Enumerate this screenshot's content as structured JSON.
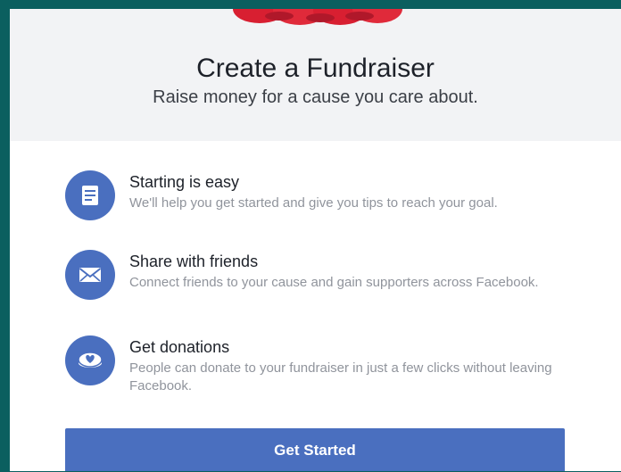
{
  "header": {
    "title": "Create a Fundraiser",
    "subtitle": "Raise money for a cause you care about."
  },
  "features": [
    {
      "icon": "document-icon",
      "title": "Starting is easy",
      "description": "We'll help you get started and give you tips to reach your goal."
    },
    {
      "icon": "envelope-icon",
      "title": "Share with friends",
      "description": "Connect friends to your cause and gain supporters across Facebook."
    },
    {
      "icon": "heart-coin-icon",
      "title": "Get donations",
      "description": "People can donate to your fundraiser in just a few clicks without leaving Facebook."
    }
  ],
  "cta": {
    "label": "Get Started"
  },
  "colors": {
    "accent": "#4a6fbf",
    "frame": "#0b5f5f",
    "header_bg": "#f2f3f5",
    "hero_red": "#e02a3a"
  }
}
